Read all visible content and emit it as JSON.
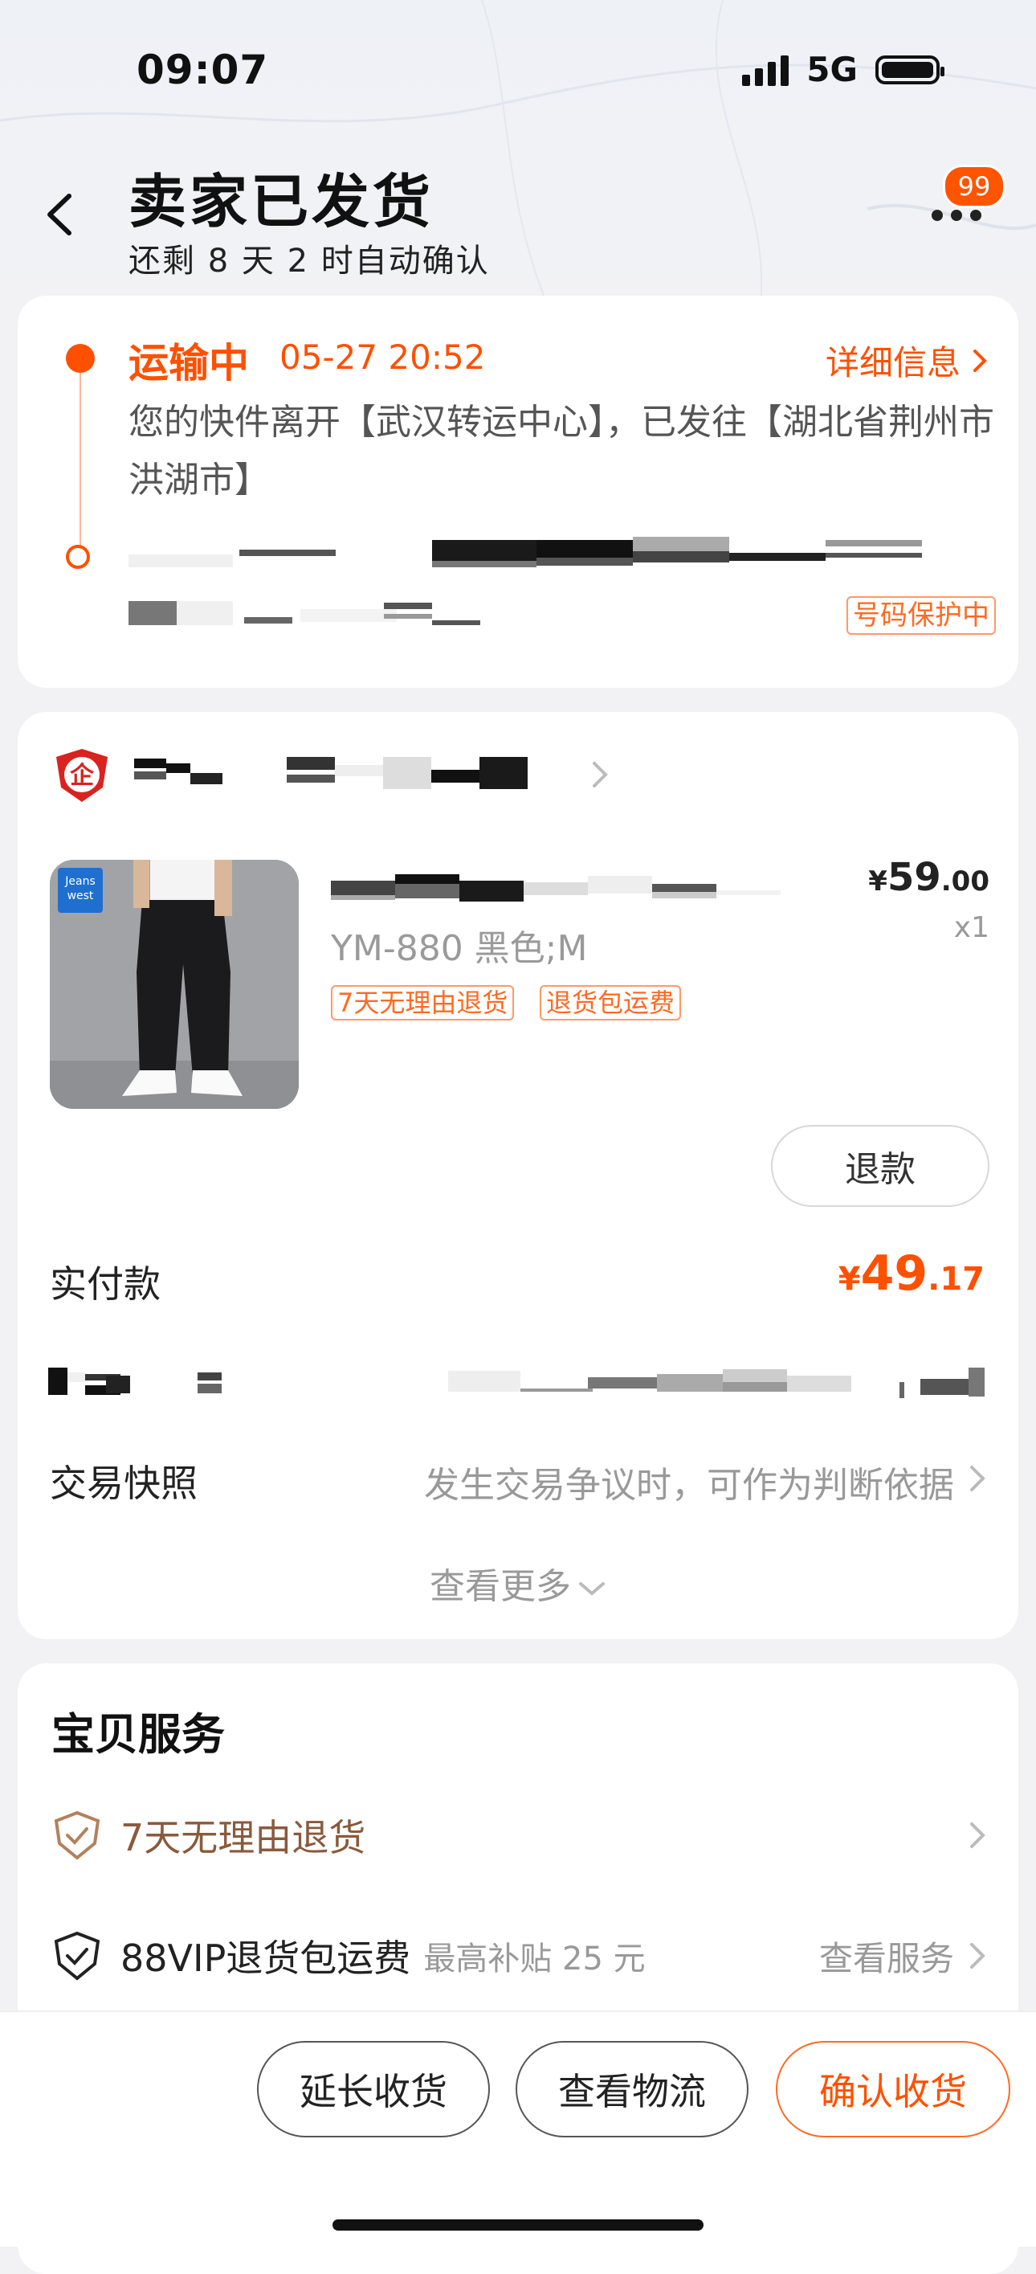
{
  "status_bar": {
    "time": "09:07",
    "network": "5G"
  },
  "header": {
    "title": "卖家已发货",
    "subtitle": "还剩 8 天 2 时自动确认",
    "message_count": "99"
  },
  "logistics": {
    "status": "运输中",
    "time": "05-27 20:52",
    "detail_link": "详细信息",
    "text": "您的快件离开【武汉转运中心】，已发往【湖北省荆州市洪湖市】",
    "protect_badge": "号码保护中"
  },
  "order": {
    "product": {
      "brand_logo_text": "Jeans west",
      "spec": "YM-880 黑色;M",
      "tags": [
        "7天无理由退货",
        "退货包运费"
      ],
      "price_symbol": "¥",
      "price_int": "59",
      "price_dec": ".00",
      "qty": "x1"
    },
    "refund_button": "退款",
    "paid": {
      "label": "实付款",
      "symbol": "¥",
      "int": "49",
      "dec": ".17"
    },
    "snapshot": {
      "label": "交易快照",
      "hint": "发生交易争议时，可作为判断依据"
    },
    "see_more": "查看更多"
  },
  "services": {
    "title": "宝贝服务",
    "items": [
      {
        "name": "7天无理由退货",
        "sub": "",
        "right": "",
        "color": "#8a5a3c"
      },
      {
        "name": "88VIP退货包运费",
        "sub": "最高补贴 25 元",
        "right": "查看服务",
        "color": "#222222"
      }
    ]
  },
  "bottom_bar": {
    "extend": "延长收货",
    "logistics": "查看物流",
    "confirm": "确认收货"
  },
  "colors": {
    "accent": "#ff5000"
  }
}
